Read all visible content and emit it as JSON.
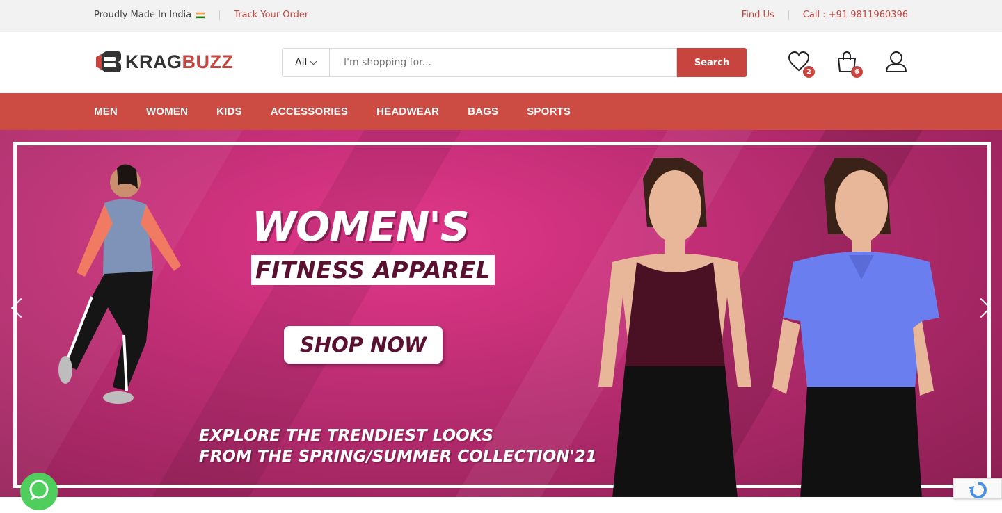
{
  "topbar": {
    "made_in": "Proudly Made In India",
    "track_order": "Track Your Order",
    "find_us": "Find Us",
    "call": "Call : +91 9811960396"
  },
  "brand": {
    "name_part1": "KRAG",
    "name_part2": "BUZZ",
    "accent": "#c8453f"
  },
  "search": {
    "category": "All",
    "placeholder": "I'm shopping for...",
    "button": "Search"
  },
  "header_icons": {
    "wishlist_count": "2",
    "cart_count": "6"
  },
  "nav": {
    "items": [
      "MEN",
      "WOMEN",
      "KIDS",
      "ACCESSORIES",
      "HEADWEAR",
      "BAGS",
      "SPORTS"
    ]
  },
  "hero": {
    "headline": "WOMEN'S",
    "subheadline": "FITNESS APPAREL",
    "cta": "SHOP NOW",
    "tagline_line1": "EXPLORE THE TRENDIEST LOOKS",
    "tagline_line2": "FROM THE SPRING/SUMMER COLLECTION'21"
  }
}
